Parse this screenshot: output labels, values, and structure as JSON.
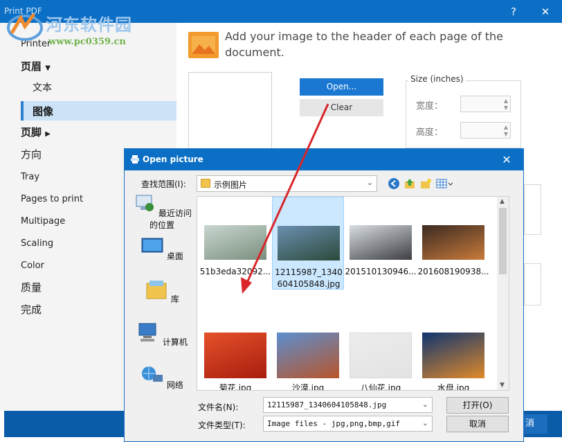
{
  "window": {
    "title": "Print PDF",
    "help_label": "?",
    "close_label": "✕"
  },
  "watermark": {
    "name_cn": "河东软件园",
    "url": "www.pc0359.cn"
  },
  "sidebar": {
    "printer": "Printer",
    "header": "页眉",
    "text": "文本",
    "image": "图像",
    "footer": "页脚",
    "orientation": "方向",
    "tray": "Tray",
    "pages_to_print": "Pages to print",
    "multipage": "Multipage",
    "scaling": "Scaling",
    "color": "Color",
    "quality": "质量",
    "finish": "完成"
  },
  "content": {
    "description": "Add your image to the header of each page of the document.",
    "open_button": "Open...",
    "clear_button": "Clear",
    "size_legend": "Size (inches)",
    "width_label": "宽度：",
    "height_label": "高度：",
    "bottom_button_partial": "消"
  },
  "dialog": {
    "title": "Open picture",
    "close_label": "✕",
    "look_in_label": "查找范围(I):",
    "look_in_value": "示例图片",
    "places": [
      "最近访问的位置",
      "桌面",
      "库",
      "计算机",
      "网络"
    ],
    "files": [
      {
        "name": "51b3eda32092...",
        "colors": [
          "#c9d6cf",
          "#7a8f7e"
        ]
      },
      {
        "name": "12115987_1340604105848.jpg",
        "colors": [
          "#6b8fb0",
          "#2b4a3a"
        ]
      },
      {
        "name": "201510130946...",
        "colors": [
          "#d9dee2",
          "#3c3e42"
        ]
      },
      {
        "name": "201608190938...",
        "colors": [
          "#3a2a22",
          "#c97a3a"
        ]
      },
      {
        "name": "菊花.jpg",
        "colors": [
          "#e4512a",
          "#a81d0e"
        ]
      },
      {
        "name": "沙漠.jpg",
        "colors": [
          "#5b8fd0",
          "#b8552a"
        ]
      },
      {
        "name": "八仙花.jpg",
        "colors": [
          "#ececec",
          "#e3e3e3"
        ]
      },
      {
        "name": "水母.jpg",
        "colors": [
          "#0f3470",
          "#e08a2a"
        ]
      }
    ],
    "filename_label": "文件名(N):",
    "filename_value": "12115987_1340604105848.jpg",
    "filetype_label": "文件类型(T):",
    "filetype_value": "Image files - jpg,png,bmp,gif",
    "open_button": "打开(O)",
    "cancel_button": "取消"
  },
  "colors": {
    "titlebar": "#0b6fc6",
    "accent": "#1a78d3",
    "annotation_arrow": "#d8262a"
  }
}
